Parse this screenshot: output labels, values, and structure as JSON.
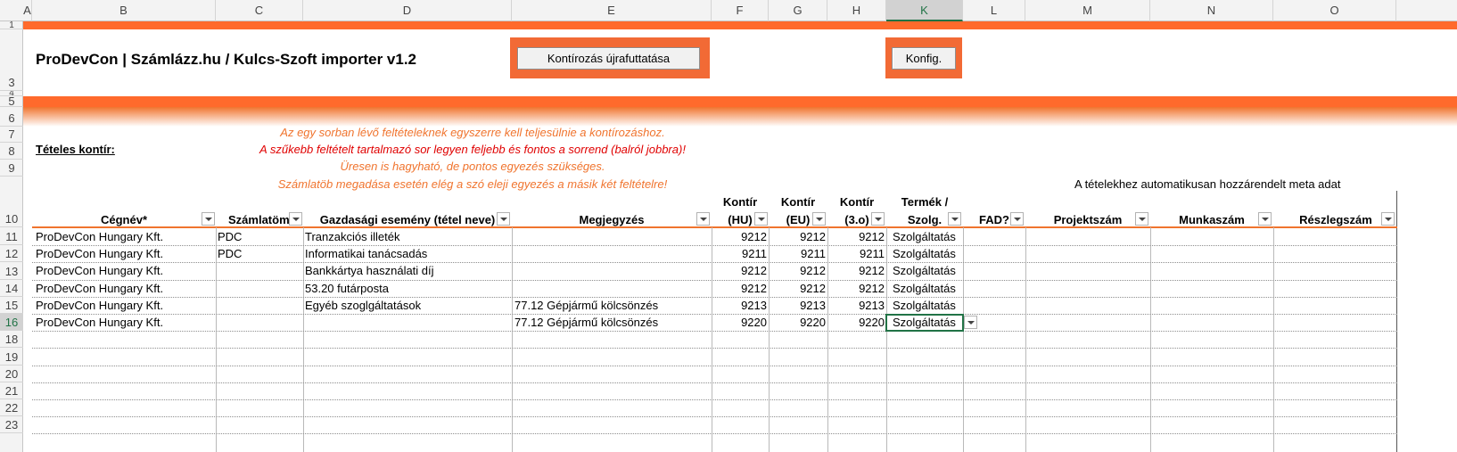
{
  "columns": [
    "A",
    "B",
    "C",
    "D",
    "E",
    "F",
    "G",
    "H",
    "K",
    "L",
    "M",
    "N",
    "O"
  ],
  "rows": [
    "1",
    "3",
    "4",
    "5",
    "6",
    "7",
    "8",
    "9",
    "10",
    "11",
    "12",
    "13",
    "14",
    "15",
    "16",
    "18",
    "19",
    "20",
    "21",
    "22",
    "23"
  ],
  "title": "ProDevCon | Számlázz.hu / Kulcs-Szoft importer v1.2",
  "buttons": {
    "rerun": "Kontírozás újrafuttatása",
    "config": "Konfig."
  },
  "section_label": "Tételes kontír:",
  "notes": [
    "Az egy sorban lévő feltételeknek egyszerre kell teljesülnie a kontírozáshoz.",
    "A szűkebb feltételt tartalmazó sor legyen feljebb és fontos a sorrend (balról jobbra)!",
    "Üresen is hagyható, de pontos egyezés szükséges.",
    "Számlatöb megadása esetén elég a szó eleji egyezés a másik két feltételre!"
  ],
  "meta_note": "A tételekhez automatikusan hozzárendelt meta adat",
  "headers": {
    "cegnev": "Cégnév*",
    "szamlatomb": "Számlatömb",
    "esemeny": "Gazdasági esemény (tétel neve)",
    "megjegyzes": "Megjegyzés",
    "kontir_hu_1": "Kontír",
    "kontir_hu_2": "(HU)",
    "kontir_eu_1": "Kontír",
    "kontir_eu_2": "(EU)",
    "kontir_3o_1": "Kontír",
    "kontir_3o_2": "(3.o)",
    "termek_1": "Termék /",
    "termek_2": "Szolg.",
    "fad": "FAD?",
    "projekt": "Projektszám",
    "munka": "Munkaszám",
    "reszleg": "Részlegszám"
  },
  "table": [
    {
      "cegnev": "ProDevCon Hungary Kft.",
      "szamlatomb": "PDC",
      "esemeny": "Tranzakciós illeték",
      "megjegyzes": "",
      "hu": "9212",
      "eu": "9212",
      "o3": "9212",
      "termek": "Szolgáltatás"
    },
    {
      "cegnev": "ProDevCon Hungary Kft.",
      "szamlatomb": "PDC",
      "esemeny": "Informatikai tanácsadás",
      "megjegyzes": "",
      "hu": "9211",
      "eu": "9211",
      "o3": "9211",
      "termek": "Szolgáltatás"
    },
    {
      "cegnev": "ProDevCon Hungary Kft.",
      "szamlatomb": "",
      "esemeny": "Bankkártya használati díj",
      "megjegyzes": "",
      "hu": "9212",
      "eu": "9212",
      "o3": "9212",
      "termek": "Szolgáltatás"
    },
    {
      "cegnev": "ProDevCon Hungary Kft.",
      "szamlatomb": "",
      "esemeny": "53.20 futárposta",
      "megjegyzes": "",
      "hu": "9212",
      "eu": "9212",
      "o3": "9212",
      "termek": "Szolgáltatás"
    },
    {
      "cegnev": "ProDevCon Hungary Kft.",
      "szamlatomb": "",
      "esemeny": "Egyéb szoglgáltatások",
      "megjegyzes": "77.12 Gépjármű kölcsönzés",
      "hu": "9213",
      "eu": "9213",
      "o3": "9213",
      "termek": "Szolgáltatás"
    },
    {
      "cegnev": "ProDevCon Hungary Kft.",
      "szamlatomb": "",
      "esemeny": "",
      "megjegyzes": "77.12 Gépjármű kölcsönzés",
      "hu": "9220",
      "eu": "9220",
      "o3": "9220",
      "termek": "Szolgáltatás"
    }
  ]
}
